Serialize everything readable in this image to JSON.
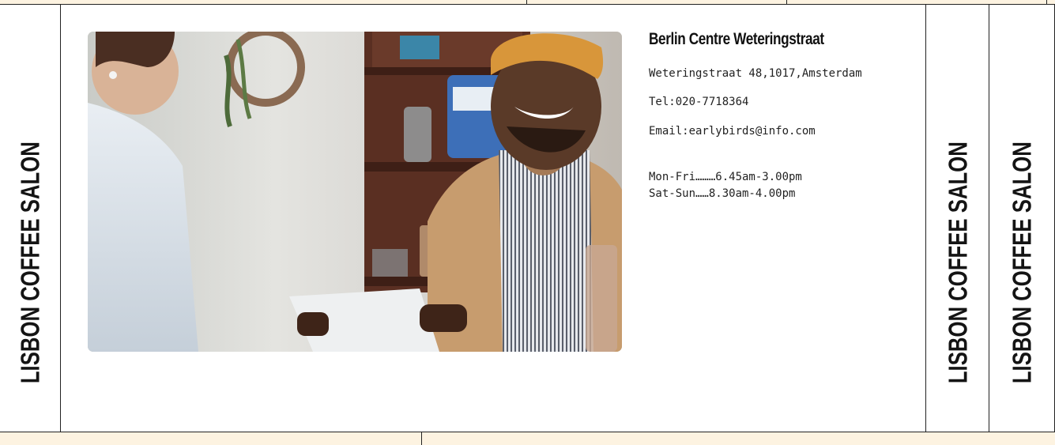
{
  "brand": {
    "vertical_label": "LISBON COFFEE SALON",
    "strip_color": "#fdf3e1"
  },
  "location": {
    "title": "Berlin Centre Weteringstraat",
    "address": "Weteringstraat 48,1017,Amsterdam",
    "tel": "Tel:020-7718364",
    "email": "Email:earlybirds@info.com",
    "hours": [
      "Mon-Fri………6.45am-3.00pm",
      "Sat-Sun……8.30am-4.00pm"
    ]
  },
  "photo": {
    "subject": "barista-with-tablet-photo"
  }
}
